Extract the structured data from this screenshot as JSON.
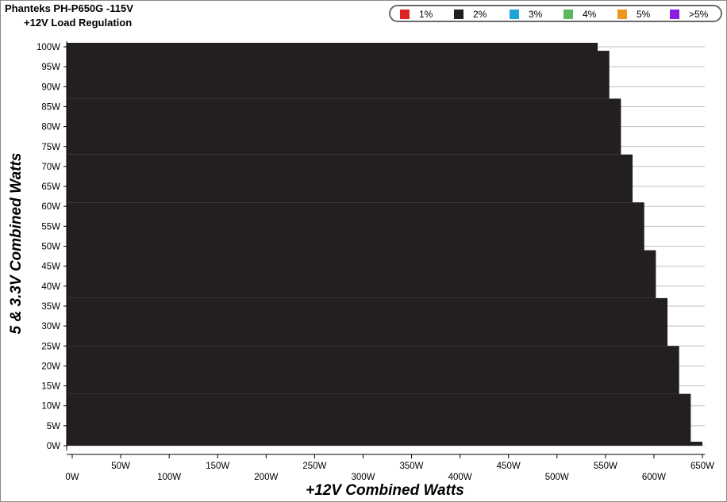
{
  "chart_data": {
    "type": "area",
    "title": "Phanteks PH-P650G -115V",
    "subtitle": "+12V Load Regulation",
    "xlabel": "+12V Combined Watts",
    "ylabel": "5 & 3.3V Combined Watts",
    "xlim": [
      0,
      650
    ],
    "ylim": [
      0,
      100
    ],
    "x_ticks": [
      "0W",
      "50W",
      "100W",
      "150W",
      "200W",
      "250W",
      "300W",
      "350W",
      "400W",
      "450W",
      "500W",
      "550W",
      "600W",
      "650W"
    ],
    "y_ticks": [
      "0W",
      "5W",
      "10W",
      "15W",
      "20W",
      "25W",
      "30W",
      "35W",
      "40W",
      "45W",
      "50W",
      "55W",
      "60W",
      "65W",
      "70W",
      "75W",
      "80W",
      "85W",
      "90W",
      "95W",
      "100W"
    ],
    "grid": true,
    "legend": [
      "1%",
      "2%",
      "3%",
      "4%",
      "5%",
      ">5%"
    ],
    "legend_position": "top-right",
    "series": [
      {
        "name": "2%",
        "steps": [
          {
            "y_from": 0,
            "y_to": 1,
            "x_max": 650
          },
          {
            "y_from": 1,
            "y_to": 13,
            "x_max": 638
          },
          {
            "y_from": 13,
            "y_to": 25,
            "x_max": 626
          },
          {
            "y_from": 25,
            "y_to": 37,
            "x_max": 614
          },
          {
            "y_from": 37,
            "y_to": 49,
            "x_max": 602
          },
          {
            "y_from": 49,
            "y_to": 61,
            "x_max": 590
          },
          {
            "y_from": 61,
            "y_to": 73,
            "x_max": 578
          },
          {
            "y_from": 73,
            "y_to": 87,
            "x_max": 566
          },
          {
            "y_from": 87,
            "y_to": 99,
            "x_max": 554
          },
          {
            "y_from": 99,
            "y_to": 101,
            "x_max": 542
          }
        ]
      }
    ]
  },
  "colors": {
    "1%": "#e02424",
    "2%": "#231f20",
    "3%": "#1ea5d8",
    "4%": "#5cb85c",
    "5%": "#f0961e",
    ">5%": "#8a1ee0",
    "grid": "#bfbfbf",
    "axis": "#000000"
  }
}
